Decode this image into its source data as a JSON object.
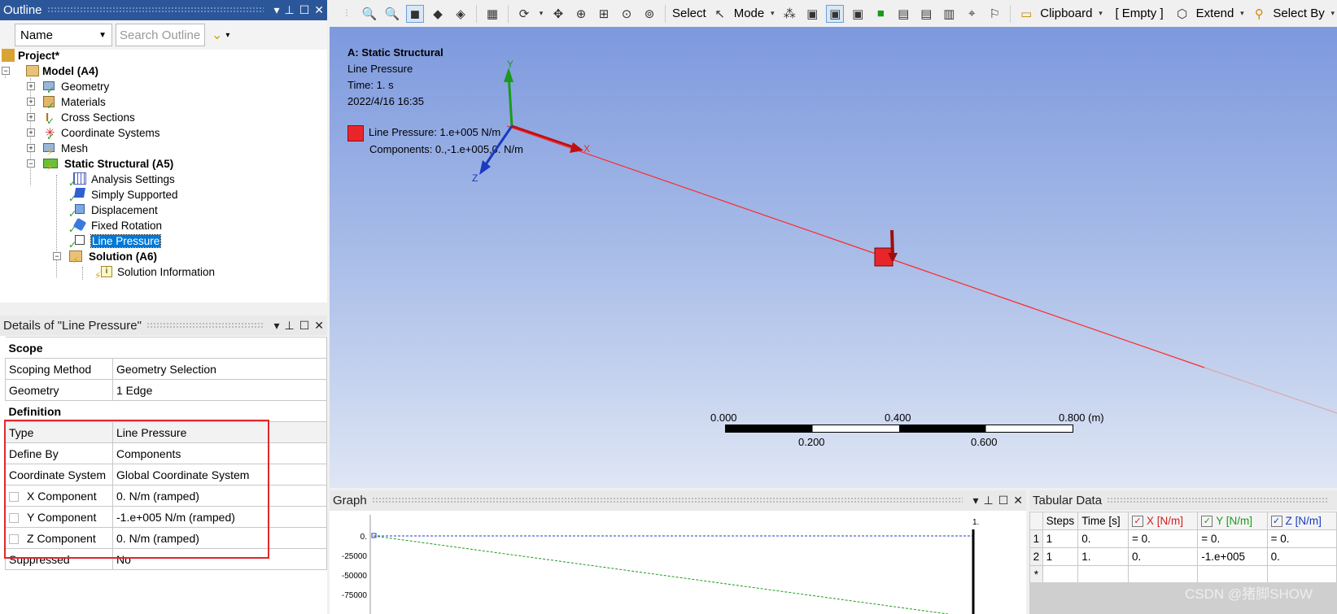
{
  "outline": {
    "title": "Outline",
    "name_select": "Name",
    "search_placeholder": "Search Outline",
    "tree": {
      "project": "Project*",
      "model": "Model (A4)",
      "geometry": "Geometry",
      "materials": "Materials",
      "cross_sections": "Cross Sections",
      "coordinate_systems": "Coordinate Systems",
      "mesh": "Mesh",
      "static_structural": "Static Structural (A5)",
      "analysis_settings": "Analysis Settings",
      "simply_supported": "Simply Supported",
      "displacement": "Displacement",
      "fixed_rotation": "Fixed Rotation",
      "line_pressure": "Line Pressure",
      "solution": "Solution (A6)",
      "solution_information": "Solution Information"
    }
  },
  "details": {
    "title": "Details of \"Line Pressure\"",
    "scope_header": "Scope",
    "scoping_method_label": "Scoping Method",
    "scoping_method_value": "Geometry Selection",
    "geometry_label": "Geometry",
    "geometry_value": "1 Edge",
    "definition_header": "Definition",
    "type_label": "Type",
    "type_value": "Line Pressure",
    "define_by_label": "Define By",
    "define_by_value": "Components",
    "coord_label": "Coordinate System",
    "coord_value": "Global Coordinate System",
    "x_label": "X Component",
    "x_value": "0. N/m  (ramped)",
    "y_label": "Y Component",
    "y_value": "-1.e+005 N/m  (ramped)",
    "z_label": "Z Component",
    "z_value": "0. N/m  (ramped)",
    "suppressed_label": "Suppressed",
    "suppressed_value": "No"
  },
  "toolbar": {
    "select": "Select",
    "mode": "Mode",
    "clipboard": "Clipboard",
    "empty": "[ Empty ]",
    "extend": "Extend",
    "select_by": "Select By"
  },
  "viewport": {
    "title": "A: Static Structural",
    "line2": "Line Pressure",
    "line3": "Time: 1. s",
    "line4": "2022/4/16 16:35",
    "legend_line1": "Line Pressure: 1.e+005 N/m",
    "legend_line2": "Components: 0.,-1.e+005,0. N/m",
    "axis_x": "X",
    "axis_y": "Y",
    "axis_z": "Z",
    "scale_0": "0.000",
    "scale_1": "0.200",
    "scale_2": "0.400",
    "scale_3": "0.600",
    "scale_4": "0.800 (m)"
  },
  "graph": {
    "title": "Graph",
    "x_end_label": "1.",
    "y_ticks": [
      "0.",
      "-25000",
      "-50000",
      "-75000"
    ]
  },
  "tabular": {
    "title": "Tabular Data",
    "headers": [
      "Steps",
      "Time [s]",
      "X [N/m]",
      "Y [N/m]",
      "Z [N/m]"
    ],
    "rows": [
      {
        "n": "1",
        "steps": "1",
        "time": "0.",
        "x": "= 0.",
        "y": "= 0.",
        "z": "= 0."
      },
      {
        "n": "2",
        "steps": "1",
        "time": "1.",
        "x": "0.",
        "y": "-1.e+005",
        "z": "0."
      }
    ],
    "new_row": "*"
  },
  "watermark": "CSDN @猪脚SHOW",
  "colors": {
    "accent": "#2b579a",
    "load": "#e8262a",
    "highlight_box": "#e0282c"
  }
}
